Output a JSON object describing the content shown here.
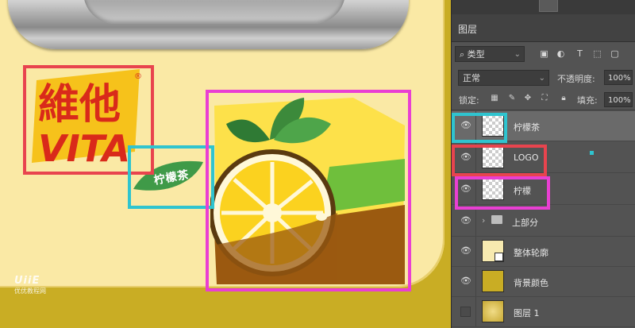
{
  "canvas": {
    "logo_lines": [
      "維他",
      "VITA"
    ],
    "logo_mark": "®",
    "leaf_label": "柠檬茶",
    "watermark_logo": "UiiE",
    "watermark_text": "优优教程网"
  },
  "panel": {
    "tab_label": "图层",
    "filter": {
      "label": "类型",
      "icons": [
        "image-icon",
        "adjustment-icon",
        "type-icon",
        "shape-icon",
        "smart-object-icon"
      ]
    },
    "blend_mode": "正常",
    "opacity_label": "不透明度:",
    "opacity_value": "100%",
    "lock_label": "锁定:",
    "fill_label": "填充:",
    "fill_value": "100%",
    "folder_arrow": "›",
    "layers": [
      {
        "name": "柠檬茶",
        "visible": true,
        "selected": true,
        "highlight": "#2fc4cf"
      },
      {
        "name": "LOGO",
        "visible": true,
        "selected": false,
        "highlight": "#e8444e"
      },
      {
        "name": "柠檬",
        "visible": true,
        "selected": false,
        "highlight": "#e93fd3"
      },
      {
        "name": "上部分",
        "visible": true,
        "selected": false,
        "type": "group"
      },
      {
        "name": "整体轮廓",
        "visible": true,
        "selected": false
      },
      {
        "name": "背景颜色",
        "visible": true,
        "selected": false
      },
      {
        "name": "图层 1",
        "visible": false,
        "selected": false
      }
    ]
  },
  "colors": {
    "canvas_bg": "#c9ad24",
    "card": "#fae9a5",
    "logo_red": "#d92a1a",
    "logo_yellow": "#f6c21b",
    "leaf_green": "#3f9a48",
    "lemon_yellow": "#fde14a",
    "tea_brown": "#9b5a10",
    "highlight_red": "#e8444e",
    "highlight_cyan": "#2fc4cf",
    "highlight_magenta": "#e93fd3"
  }
}
